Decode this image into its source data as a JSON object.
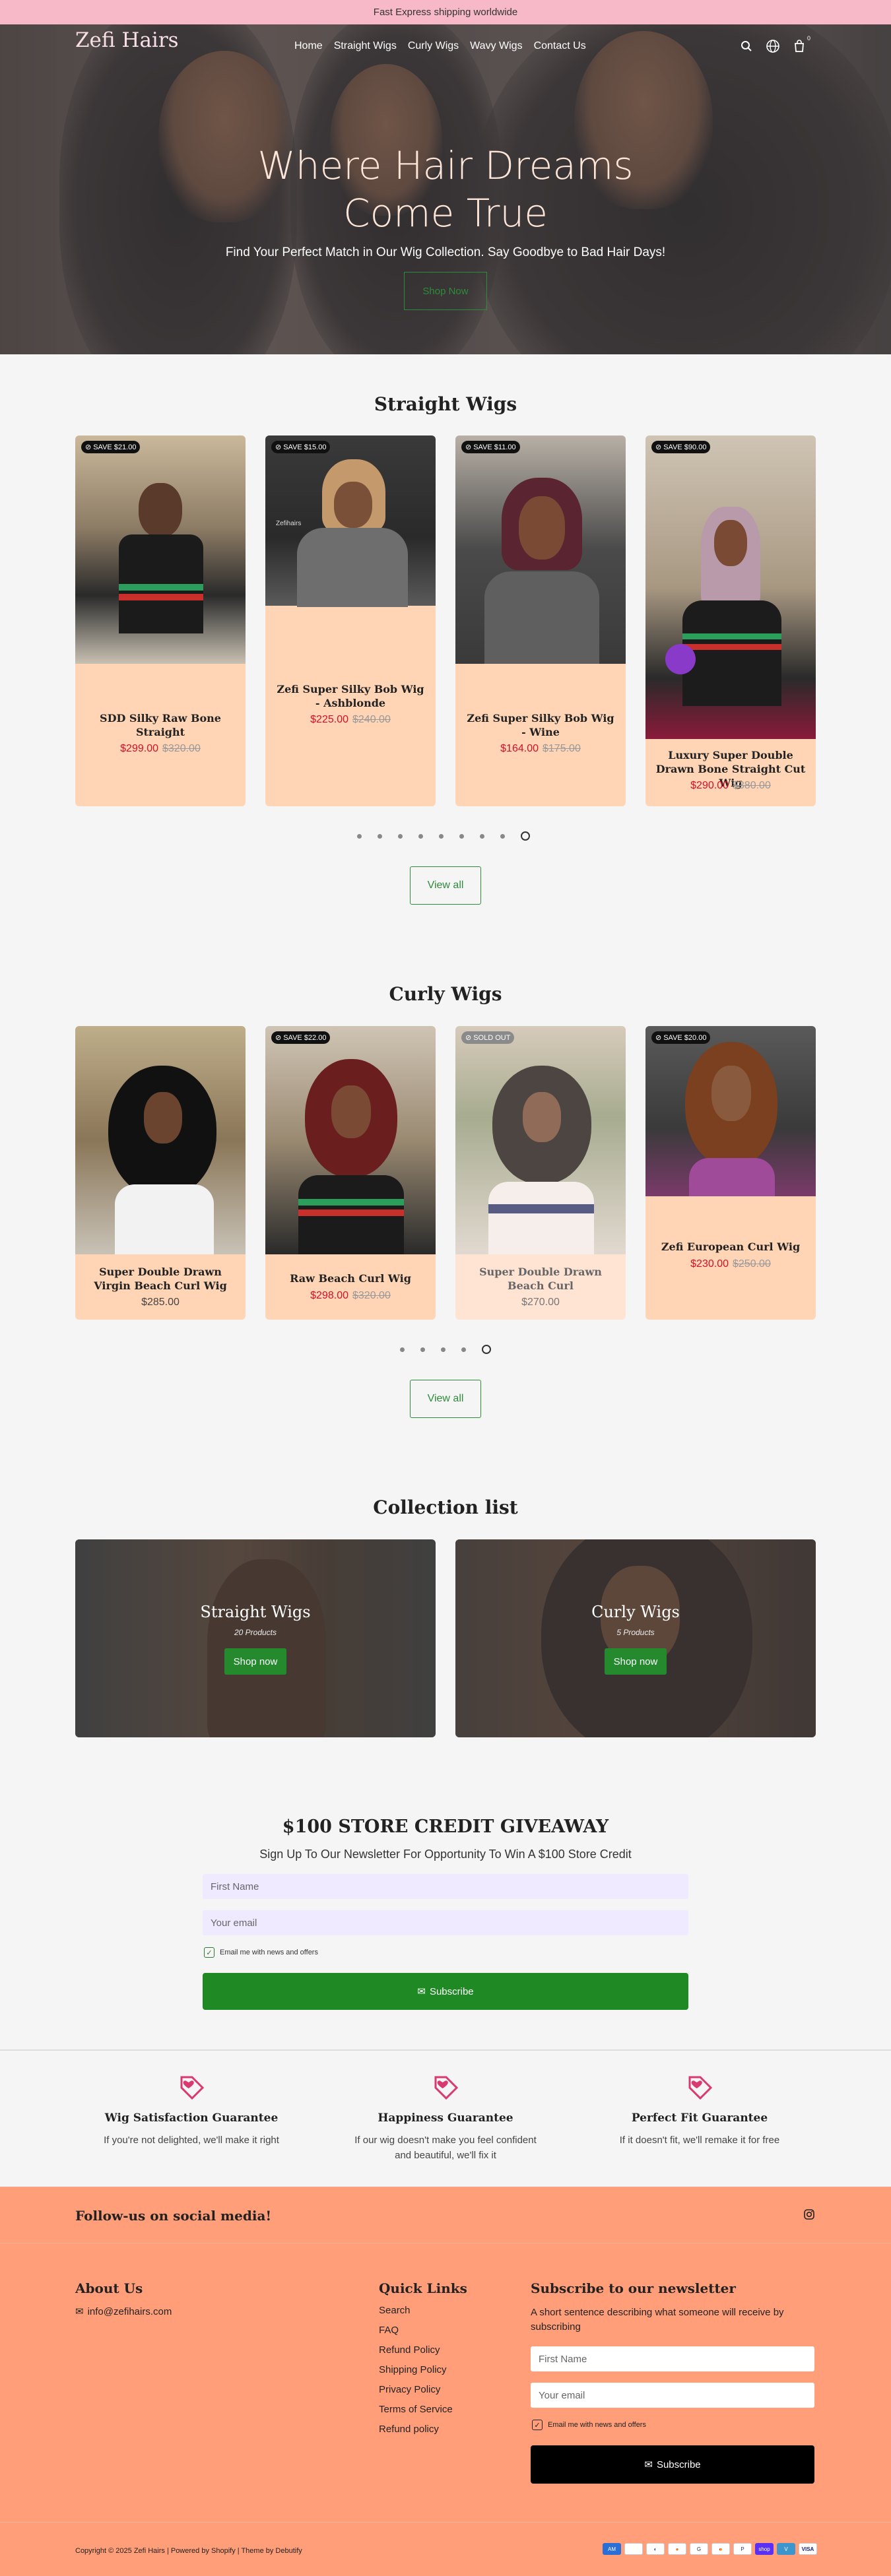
{
  "announcement": "Fast Express shipping worldwide",
  "nav": {
    "logo": "Zefi Hairs",
    "menu": [
      "Home",
      "Straight Wigs",
      "Curly Wigs",
      "Wavy Wigs",
      "Contact Us"
    ],
    "cart_count": "0"
  },
  "hero": {
    "title_line1": "Where Hair Dreams",
    "title_line2": "Come True",
    "subtitle": "Find Your Perfect Match in Our Wig Collection. Say Goodbye to Bad Hair Days!",
    "button": "Shop Now"
  },
  "straight": {
    "title": "Straight Wigs",
    "products": [
      {
        "badge": "SAVE $21.00",
        "name": "SDD Silky Raw Bone Straight",
        "price": "$299.00",
        "was": "$320.00"
      },
      {
        "badge": "SAVE $15.00",
        "name": "Zefi Super Silky Bob Wig - Ashblonde",
        "price": "$225.00",
        "was": "$240.00",
        "watermark": "Zefihairs"
      },
      {
        "badge": "SAVE $11.00",
        "name": "Zefi Super Silky Bob Wig - Wine",
        "price": "$164.00",
        "was": "$175.00"
      },
      {
        "badge": "SAVE $90.00",
        "name": "Luxury Super Double Drawn Bone Straight Cut Wig",
        "price": "$290.00",
        "was": "$380.00"
      }
    ],
    "view_all": "View all"
  },
  "curly": {
    "title": "Curly Wigs",
    "products": [
      {
        "badge": "",
        "name": "Super Double Drawn Virgin Beach Curl Wig",
        "price": "",
        "was": "",
        "regular": "$285.00"
      },
      {
        "badge": "SAVE $22.00",
        "name": "Raw Beach Curl Wig",
        "price": "$298.00",
        "was": "$320.00"
      },
      {
        "badge": "SOLD OUT",
        "name": "Super Double Drawn Beach Curl",
        "price": "",
        "was": "",
        "regular": "$270.00"
      },
      {
        "badge": "SAVE $20.00",
        "name": "Zefi European Curl Wig",
        "price": "$230.00",
        "was": "$250.00"
      }
    ],
    "view_all": "View all"
  },
  "collection": {
    "title": "Collection list",
    "items": [
      {
        "title": "Straight Wigs",
        "count": "20 Products",
        "button": "Shop now"
      },
      {
        "title": "Curly Wigs",
        "count": "5 Products",
        "button": "Shop now"
      }
    ]
  },
  "giveaway": {
    "title": "$100 STORE CREDIT GIVEAWAY",
    "subtitle": "Sign Up To Our Newsletter For Opportunity To Win A $100 Store Credit",
    "first_name_placeholder": "First Name",
    "email_placeholder": "Your email",
    "consent": "Email me with news and offers",
    "button": "Subscribe"
  },
  "guarantees": [
    {
      "title": "Wig Satisfaction Guarantee",
      "desc": "If you're not delighted, we'll make it right"
    },
    {
      "title": "Happiness Guarantee",
      "desc": "If our wig doesn't make you feel confident and beautiful, we'll fix it"
    },
    {
      "title": "Perfect Fit Guarantee",
      "desc": "If it doesn't fit, we'll remake it for free"
    }
  ],
  "footer": {
    "follow": "Follow-us on social media!",
    "about_title": "About Us",
    "email": "info@zefihairs.com",
    "links_title": "Quick Links",
    "links": [
      "Search",
      "FAQ",
      "Refund Policy",
      "Shipping Policy",
      "Privacy Policy",
      "Terms of Service",
      "Refund policy"
    ],
    "news_title": "Subscribe to our newsletter",
    "news_desc": "A short sentence describing what someone will receive by subscribing",
    "first_name_placeholder": "First Name",
    "email_placeholder": "Your email",
    "consent": "Email me with news and offers",
    "button": "Subscribe",
    "copyright": "Copyright © 2025 Zefi Hairs | Powered by Shopify | Theme by Debutify",
    "payments": [
      "AMEX",
      "Apple Pay",
      "Diners",
      "Discover",
      "G Pay",
      "Mastercard",
      "PayPal",
      "Shop Pay",
      "Venmo",
      "Visa"
    ]
  },
  "colors": {
    "accent": "#ff9e78",
    "green": "#258a2e",
    "sale": "#d1102a",
    "card": "#ffd5b6",
    "announcement": "#f7b9c8"
  }
}
